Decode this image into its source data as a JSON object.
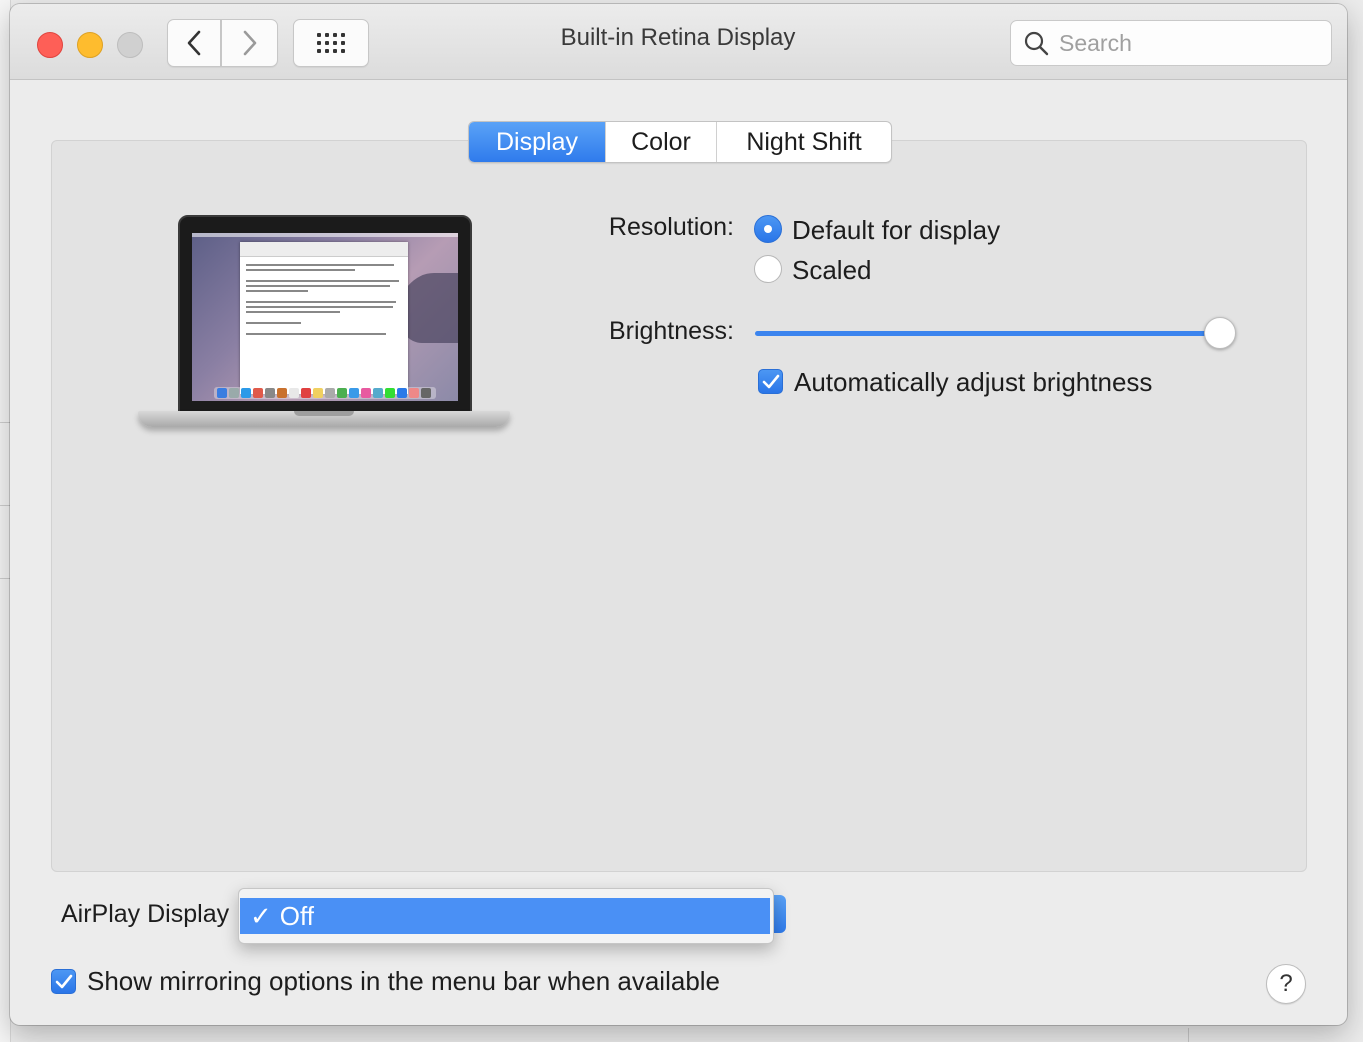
{
  "window": {
    "title": "Built-in Retina Display",
    "search_placeholder": "Search"
  },
  "tabs": [
    {
      "label": "Display",
      "active": true
    },
    {
      "label": "Color",
      "active": false
    },
    {
      "label": "Night Shift",
      "active": false
    }
  ],
  "display": {
    "resolution_label": "Resolution:",
    "resolution_options": [
      {
        "label": "Default for display",
        "selected": true
      },
      {
        "label": "Scaled",
        "selected": false
      }
    ],
    "brightness_label": "Brightness:",
    "brightness_level": 1.0,
    "auto_brightness_label": "Automatically adjust brightness",
    "auto_brightness_checked": true
  },
  "airplay": {
    "label": "AirPlay Display",
    "selected_option": "Off",
    "check_mark": "✓"
  },
  "mirroring": {
    "label": "Show mirroring options in the menu bar when available",
    "checked": true
  },
  "help": {
    "label": "?"
  },
  "colors": {
    "accent": "#2f7bec",
    "close": "#fe5f57",
    "minimize": "#febc2e",
    "zoom_disabled": "#d0d0d0"
  }
}
